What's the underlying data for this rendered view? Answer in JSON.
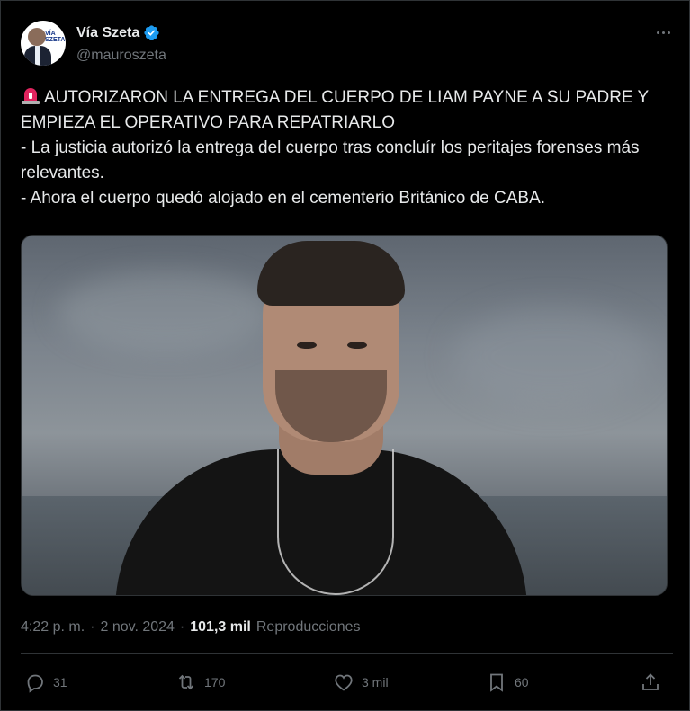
{
  "author": {
    "display_name": "Vía Szeta",
    "handle": "@mauroszeta",
    "verified": true,
    "avatar_brand_text": "VÍA SZETA"
  },
  "icons": {
    "verified": "verified-badge-icon",
    "more": "more-options-icon",
    "alert": "rotating-light-icon",
    "reply": "reply-icon",
    "retweet": "retweet-icon",
    "like": "like-icon",
    "bookmark": "bookmark-icon",
    "share": "share-icon"
  },
  "tweet": {
    "headline": "AUTORIZARON LA ENTREGA DEL CUERPO DE LIAM PAYNE A SU PADRE Y EMPIEZA EL OPERATIVO PARA REPATRIARLO",
    "line1": "- La justicia autorizó la entrega del cuerpo tras concluír los peritajes forenses más relevantes.",
    "line2": "- Ahora el cuerpo quedó alojado en el cementerio Británico de CABA."
  },
  "meta": {
    "time": "4:22 p. m.",
    "separator": "·",
    "date": "2 nov. 2024",
    "separator2": "·",
    "views_count": "101,3 mil",
    "views_label": "Reproducciones"
  },
  "actions": {
    "reply_count": "31",
    "retweet_count": "170",
    "like_count": "3 mil",
    "bookmark_count": "60"
  },
  "colors": {
    "background": "#000000",
    "text": "#e7e9ea",
    "muted": "#71767b",
    "verified": "#1d9bf0",
    "alert": "#e0245e",
    "border": "#2f3336"
  }
}
